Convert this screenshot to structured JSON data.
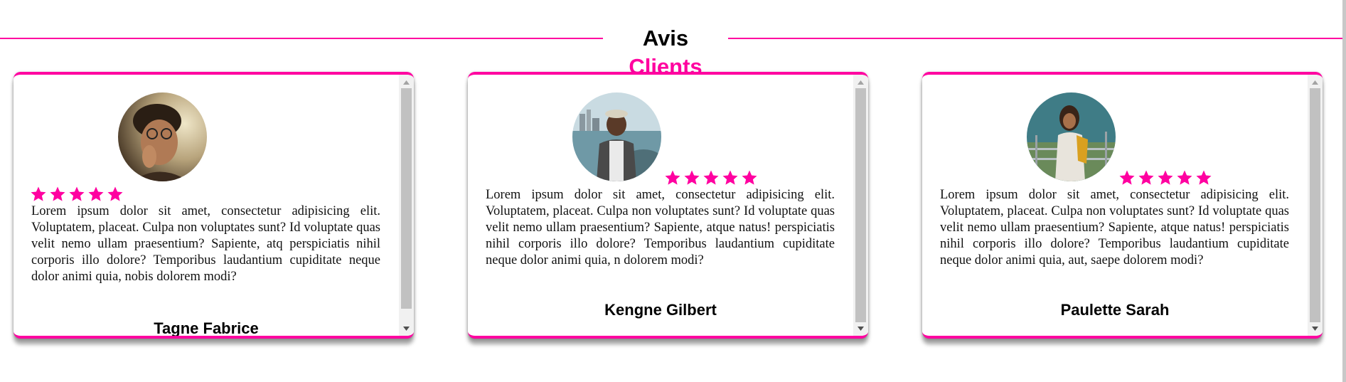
{
  "heading": {
    "part1": "Avis",
    "part2": "Clients"
  },
  "colors": {
    "accent": "#ff00a0",
    "scrollbar_track": "#f1f1f1",
    "scrollbar_thumb": "#c1c1c1"
  },
  "star_icon": "star-icon",
  "testimonials": [
    {
      "rating": 5,
      "review": "Lorem ipsum dolor sit amet, consectetur adipisicing elit. Voluptatem, placeat. Culpa non voluptates sunt? Id voluptate quas velit nemo ullam praesentium? Sapiente, atq perspiciatis nihil corporis illo dolore? Temporibus laudantium cupiditate neque dolor animi quia, nobis dolorem modi?",
      "name": "Tagne Fabrice"
    },
    {
      "rating": 5,
      "review": "Lorem ipsum dolor sit amet, consectetur adipisicing elit. Voluptatem, placeat. Culpa non voluptates sunt? Id voluptate quas velit nemo ullam praesentium? Sapiente, atque natus! perspiciatis nihil corporis illo dolore? Temporibus laudantium cupiditate neque dolor animi quia, n dolorem modi?",
      "name": "Kengne Gilbert"
    },
    {
      "rating": 5,
      "review": "Lorem ipsum dolor sit amet, consectetur adipisicing elit. Voluptatem, placeat. Culpa non voluptates sunt? Id voluptate quas velit nemo ullam praesentium? Sapiente, atque natus! perspiciatis nihil corporis illo dolore? Temporibus laudantium cupiditate neque dolor animi quia, aut, saepe dolorem modi?",
      "name": "Paulette Sarah"
    }
  ]
}
